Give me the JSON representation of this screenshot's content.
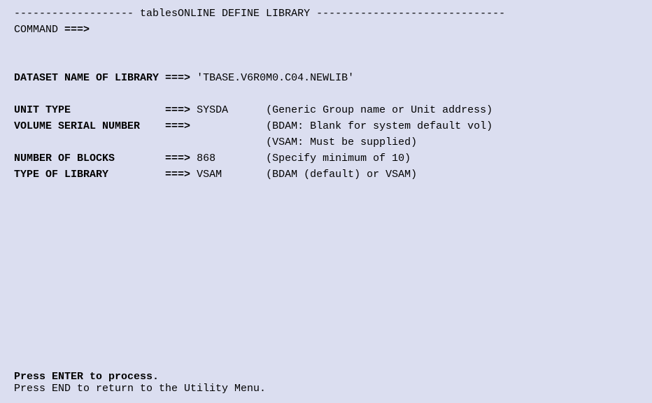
{
  "header": {
    "title_line": "------------------- tablesONLINE DEFINE LIBRARY ------------------------------",
    "command_label": "COMMAND ",
    "command_arrow": "===>",
    "command_value": ""
  },
  "fields": {
    "dataset_name": {
      "label": "DATASET NAME OF LIBRARY ",
      "arrow": "===>",
      "value": " 'TBASE.V6R0M0.C04.NEWLIB'"
    },
    "unit_type": {
      "label": "UNIT TYPE               ",
      "arrow": "===>",
      "value": " SYSDA      ",
      "hint": "(Generic Group name or Unit address)"
    },
    "volume_serial": {
      "label": "VOLUME SERIAL NUMBER    ",
      "arrow": "===>",
      "value": "            ",
      "hint": "(BDAM: Blank for system default vol)",
      "hint2_indent": "                             ",
      "hint2": "(VSAM: Must be supplied)"
    },
    "number_of_blocks": {
      "label": "NUMBER OF BLOCKS        ",
      "arrow": "===>",
      "value": " 868        ",
      "hint": "(Specify minimum of 10)"
    },
    "type_of_library": {
      "label": "TYPE OF LIBRARY         ",
      "arrow": "===>",
      "value": " VSAM       ",
      "hint": "(BDAM (default) or VSAM)"
    }
  },
  "footer": {
    "enter_msg": "Press ENTER to process.",
    "end_msg": "Press END to return to the Utility Menu."
  }
}
